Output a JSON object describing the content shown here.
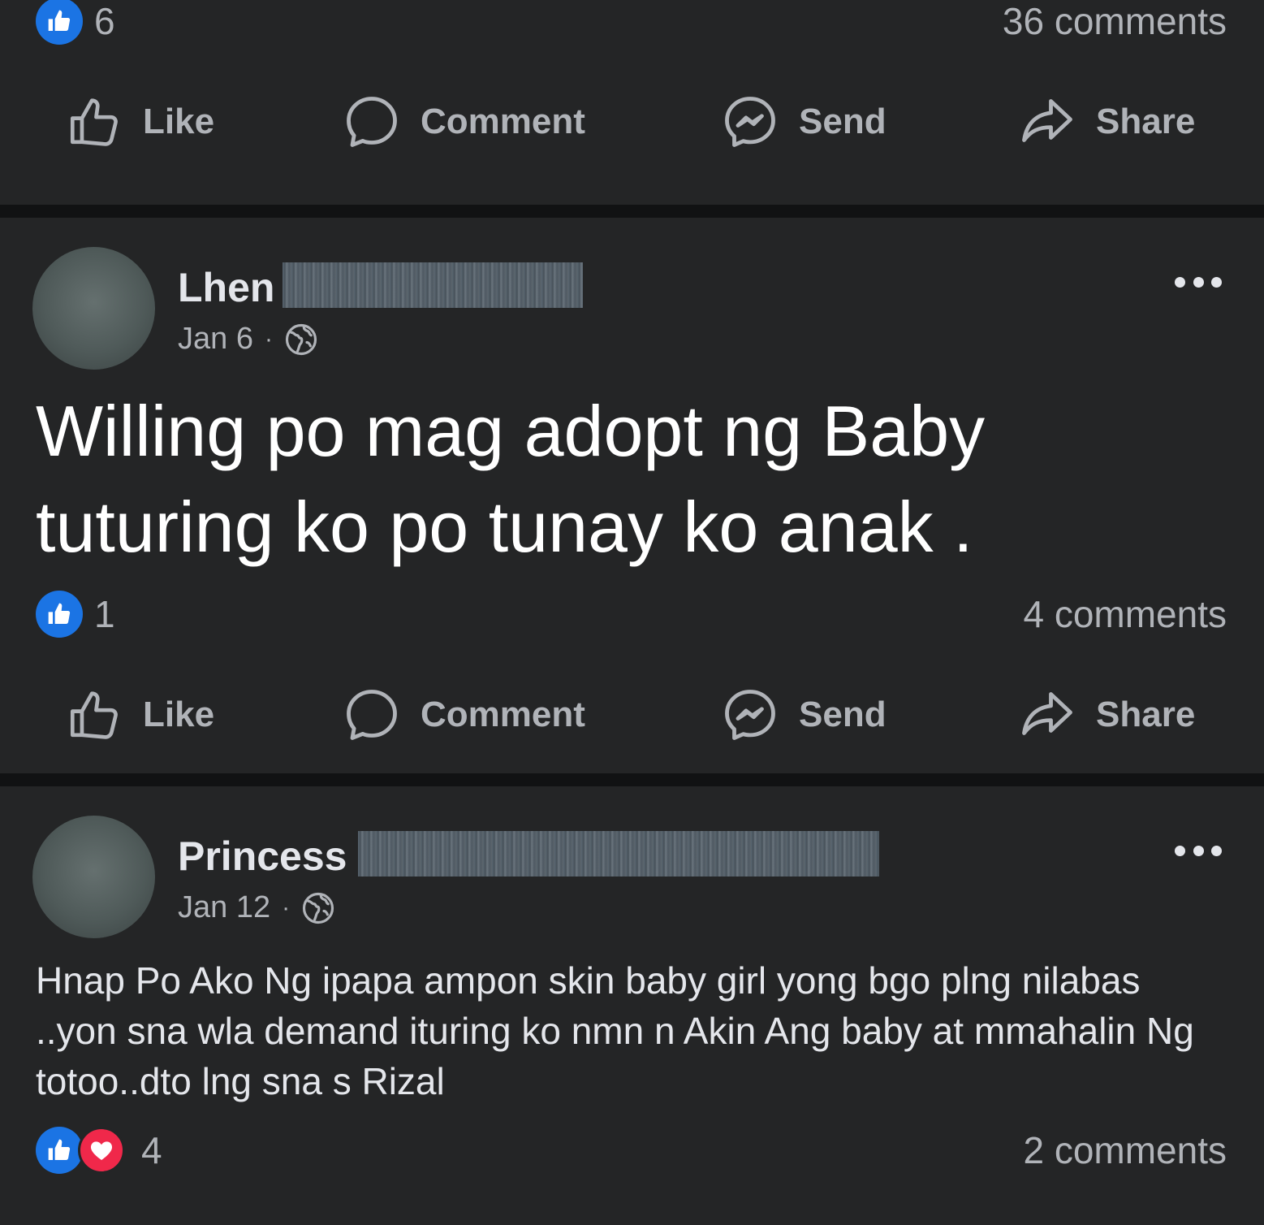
{
  "colors": {
    "background": "#18191a",
    "card": "#242526",
    "like_blue": "#1b74e4",
    "love_red": "#f0284a",
    "secondary_text": "#b0b3b8"
  },
  "actions": {
    "like": "Like",
    "comment": "Comment",
    "send": "Send",
    "share": "Share"
  },
  "post_prev": {
    "reaction_count": "6",
    "comments": "36 comments",
    "reactions": [
      "like-icon"
    ]
  },
  "post1": {
    "author": "Lhen",
    "date": "Jan 6",
    "separator": "·",
    "privacy_icon": "globe-icon",
    "text": "Willing po mag adopt ng Baby tuturing ko po tunay ko anak .",
    "reaction_count": "1",
    "comments": "4 comments",
    "reactions": [
      "like-icon"
    ]
  },
  "post2": {
    "author": "Princess",
    "date": "Jan 12",
    "separator": "·",
    "privacy_icon": "globe-icon",
    "text": "Hnap Po Ako Ng ipapa ampon skin baby girl yong bgo plng nilabas ..yon sna wla demand ituring ko nmn n Akin Ang baby at mmahalin Ng totoo..dto lng sna s Rizal",
    "reaction_count": "4",
    "comments": "2 comments",
    "reactions": [
      "like-icon",
      "heart-icon"
    ]
  }
}
